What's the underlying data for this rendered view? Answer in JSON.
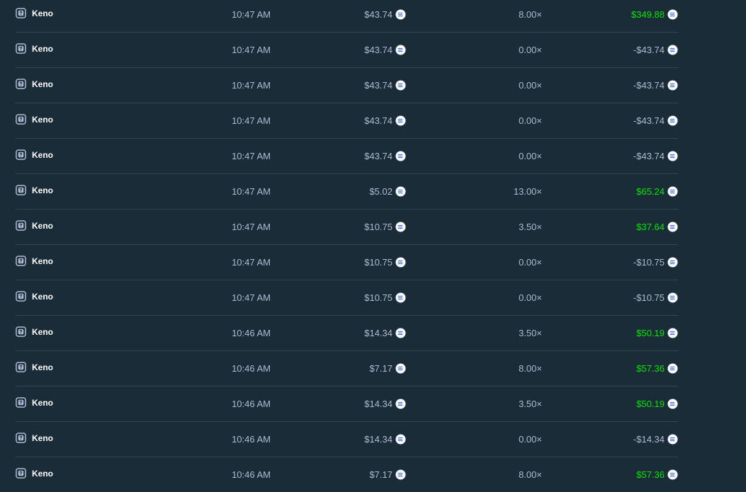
{
  "colors": {
    "background": "#1a2c38",
    "divider": "#2f4553",
    "text_muted": "#b1bad3",
    "text_game": "#ffffff",
    "win": "#00e701"
  },
  "icons": {
    "game": "keno-icon",
    "currency": "coin-icon"
  },
  "rows": [
    {
      "game": "Keno",
      "time": "10:47 AM",
      "bet": "$43.74",
      "multiplier": "8.00×",
      "payout": "$349.88",
      "win": true
    },
    {
      "game": "Keno",
      "time": "10:47 AM",
      "bet": "$43.74",
      "multiplier": "0.00×",
      "payout": "-$43.74",
      "win": false
    },
    {
      "game": "Keno",
      "time": "10:47 AM",
      "bet": "$43.74",
      "multiplier": "0.00×",
      "payout": "-$43.74",
      "win": false
    },
    {
      "game": "Keno",
      "time": "10:47 AM",
      "bet": "$43.74",
      "multiplier": "0.00×",
      "payout": "-$43.74",
      "win": false
    },
    {
      "game": "Keno",
      "time": "10:47 AM",
      "bet": "$43.74",
      "multiplier": "0.00×",
      "payout": "-$43.74",
      "win": false
    },
    {
      "game": "Keno",
      "time": "10:47 AM",
      "bet": "$5.02",
      "multiplier": "13.00×",
      "payout": "$65.24",
      "win": true
    },
    {
      "game": "Keno",
      "time": "10:47 AM",
      "bet": "$10.75",
      "multiplier": "3.50×",
      "payout": "$37.64",
      "win": true
    },
    {
      "game": "Keno",
      "time": "10:47 AM",
      "bet": "$10.75",
      "multiplier": "0.00×",
      "payout": "-$10.75",
      "win": false
    },
    {
      "game": "Keno",
      "time": "10:47 AM",
      "bet": "$10.75",
      "multiplier": "0.00×",
      "payout": "-$10.75",
      "win": false
    },
    {
      "game": "Keno",
      "time": "10:46 AM",
      "bet": "$14.34",
      "multiplier": "3.50×",
      "payout": "$50.19",
      "win": true
    },
    {
      "game": "Keno",
      "time": "10:46 AM",
      "bet": "$7.17",
      "multiplier": "8.00×",
      "payout": "$57.36",
      "win": true
    },
    {
      "game": "Keno",
      "time": "10:46 AM",
      "bet": "$14.34",
      "multiplier": "3.50×",
      "payout": "$50.19",
      "win": true
    },
    {
      "game": "Keno",
      "time": "10:46 AM",
      "bet": "$14.34",
      "multiplier": "0.00×",
      "payout": "-$14.34",
      "win": false
    },
    {
      "game": "Keno",
      "time": "10:46 AM",
      "bet": "$7.17",
      "multiplier": "8.00×",
      "payout": "$57.36",
      "win": true
    }
  ]
}
